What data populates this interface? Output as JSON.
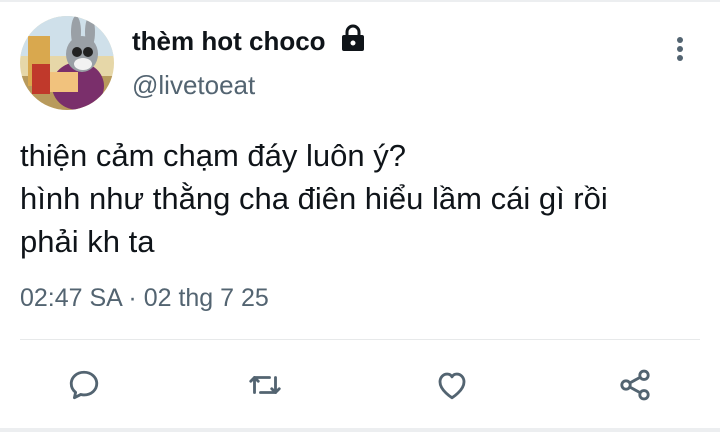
{
  "tweet": {
    "display_name": "thèm hot choco",
    "handle": "@livetoeat",
    "text_lines": [
      "thiện cảm chạm đáy luôn ý?",
      "hình như thằng cha điên hiểu lầm cái gì rồi",
      "phải kh ta"
    ],
    "timestamp": "02:47 SA · 02 thg 7 25"
  },
  "icons": {
    "lock": "lock-icon",
    "more": "more-vertical-icon",
    "reply": "reply-icon",
    "retweet": "retweet-icon",
    "like": "heart-icon",
    "share": "share-icon"
  },
  "colors": {
    "text": "#0f1419",
    "secondary": "#536471",
    "divider": "#e7e9ea"
  }
}
